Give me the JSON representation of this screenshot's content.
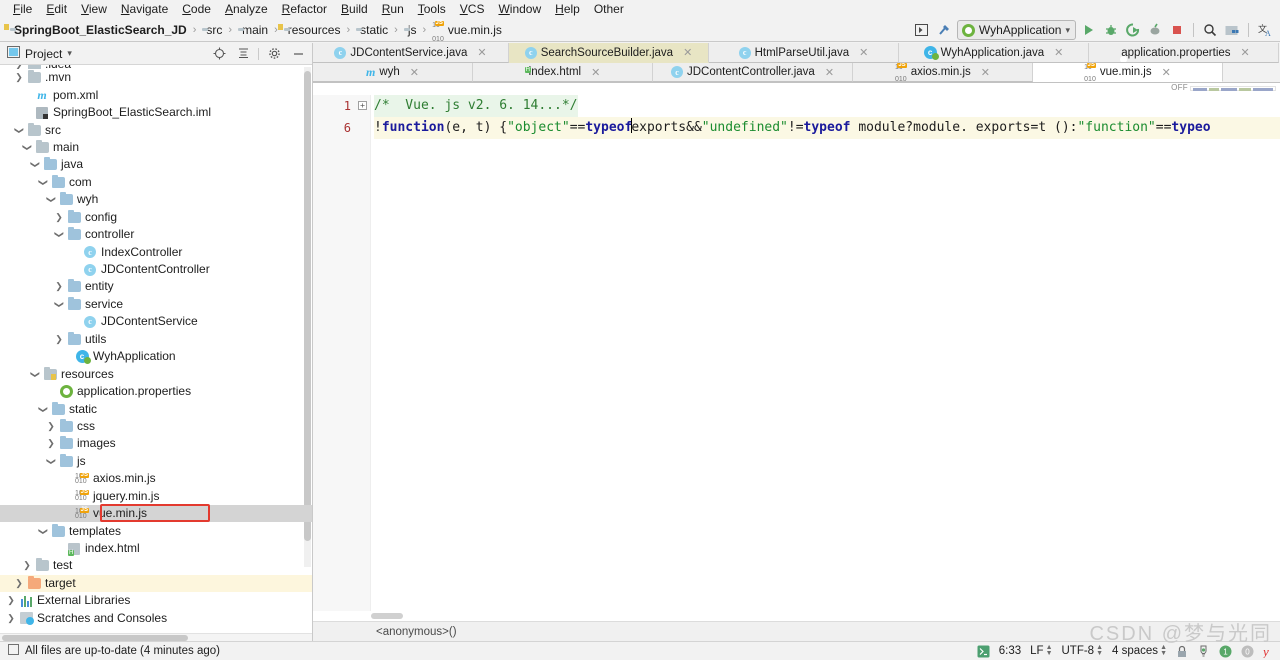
{
  "menubar": {
    "items": [
      "File",
      "Edit",
      "View",
      "Navigate",
      "Code",
      "Analyze",
      "Refactor",
      "Build",
      "Run",
      "Tools",
      "VCS",
      "Window",
      "Help",
      "Other"
    ]
  },
  "navbar": {
    "breadcrumb": [
      {
        "label": "SpringBoot_ElasticSearch_JD",
        "icon": "module-icon"
      },
      {
        "label": "src",
        "icon": "folder-icon"
      },
      {
        "label": "main",
        "icon": "folder-icon"
      },
      {
        "label": "resources",
        "icon": "resources-folder-icon"
      },
      {
        "label": "static",
        "icon": "folder-icon"
      },
      {
        "label": "js",
        "icon": "folder-icon"
      },
      {
        "label": "vue.min.js",
        "icon": "js-file-icon"
      }
    ],
    "run_config": "WyhApplication",
    "icons": [
      "select-opened-file-icon",
      "hammer-build-icon",
      "run-icon",
      "debug-icon",
      "run-coverage-icon",
      "profile-icon",
      "stop-icon",
      "search-icon",
      "project-structure-icon",
      "translate-icon"
    ]
  },
  "project_panel": {
    "title": "Project",
    "toolbar_icons": [
      "locate-icon",
      "collapse-all-icon",
      "settings-gear-icon",
      "hide-icon"
    ],
    "tree": [
      {
        "label": ".idea",
        "depth": 1,
        "arrow": "right",
        "icon": "folder-icon",
        "state": "clipped"
      },
      {
        "label": ".mvn",
        "depth": 1,
        "arrow": "right",
        "icon": "folder-icon"
      },
      {
        "label": "pom.xml",
        "depth": 2,
        "arrow": "",
        "icon": "maven-icon"
      },
      {
        "label": "SpringBoot_ElasticSearch.iml",
        "depth": 2,
        "arrow": "",
        "icon": "iml-icon"
      },
      {
        "label": "src",
        "depth": 1,
        "arrow": "down",
        "icon": "folder-icon"
      },
      {
        "label": "main",
        "depth": 2,
        "arrow": "down",
        "icon": "folder-icon"
      },
      {
        "label": "java",
        "depth": 3,
        "arrow": "down",
        "icon": "source-folder-icon"
      },
      {
        "label": "com",
        "depth": 4,
        "arrow": "down",
        "icon": "package-icon"
      },
      {
        "label": "wyh",
        "depth": 5,
        "arrow": "down",
        "icon": "package-icon"
      },
      {
        "label": "config",
        "depth": 6,
        "arrow": "right",
        "icon": "package-icon"
      },
      {
        "label": "controller",
        "depth": 6,
        "arrow": "down",
        "icon": "package-icon"
      },
      {
        "label": "IndexController",
        "depth": 8,
        "arrow": "",
        "icon": "class-icon"
      },
      {
        "label": "JDContentController",
        "depth": 8,
        "arrow": "",
        "icon": "class-icon"
      },
      {
        "label": "entity",
        "depth": 6,
        "arrow": "right",
        "icon": "package-icon"
      },
      {
        "label": "service",
        "depth": 6,
        "arrow": "down",
        "icon": "package-icon"
      },
      {
        "label": "JDContentService",
        "depth": 8,
        "arrow": "",
        "icon": "class-icon"
      },
      {
        "label": "utils",
        "depth": 6,
        "arrow": "right",
        "icon": "package-icon"
      },
      {
        "label": "WyhApplication",
        "depth": 7,
        "arrow": "",
        "icon": "spring-boot-class-icon"
      },
      {
        "label": "resources",
        "depth": 3,
        "arrow": "down",
        "icon": "resources-folder-icon"
      },
      {
        "label": "application.properties",
        "depth": 5,
        "arrow": "",
        "icon": "spring-properties-icon"
      },
      {
        "label": "static",
        "depth": 4,
        "arrow": "down",
        "icon": "package-icon"
      },
      {
        "label": "css",
        "depth": 5,
        "arrow": "right",
        "icon": "package-icon"
      },
      {
        "label": "images",
        "depth": 5,
        "arrow": "right",
        "icon": "package-icon"
      },
      {
        "label": "js",
        "depth": 5,
        "arrow": "down",
        "icon": "package-icon"
      },
      {
        "label": "axios.min.js",
        "depth": 7,
        "arrow": "",
        "icon": "js-file-icon"
      },
      {
        "label": "jquery.min.js",
        "depth": 7,
        "arrow": "",
        "icon": "js-file-icon"
      },
      {
        "label": "vue.min.js",
        "depth": 7,
        "arrow": "",
        "icon": "js-file-icon",
        "selected": true,
        "highlighted": true
      },
      {
        "label": "templates",
        "depth": 4,
        "arrow": "down",
        "icon": "package-icon"
      },
      {
        "label": "index.html",
        "depth": 6,
        "arrow": "",
        "icon": "html-file-icon"
      },
      {
        "label": "test",
        "depth": 2,
        "arrow": "right",
        "icon": "folder-icon"
      },
      {
        "label": "target",
        "depth": 1,
        "arrow": "right",
        "icon": "target-folder-icon",
        "target": true
      },
      {
        "label": "External Libraries",
        "depth": 0,
        "arrow": "right",
        "icon": "libraries-icon"
      },
      {
        "label": "Scratches and Consoles",
        "depth": 0,
        "arrow": "right",
        "icon": "scratches-icon"
      }
    ]
  },
  "editor": {
    "tabs_row1": [
      {
        "label": "JDContentService.java",
        "icon": "class-icon",
        "state": "normal",
        "closable": true
      },
      {
        "label": "SearchSourceBuilder.java",
        "icon": "class-icon",
        "state": "active-yellow",
        "closable": true
      },
      {
        "label": "HtmlParseUtil.java",
        "icon": "class-icon",
        "state": "normal",
        "closable": true
      },
      {
        "label": "WyhApplication.java",
        "icon": "spring-boot-class-icon",
        "state": "normal",
        "closable": true
      },
      {
        "label": "application.properties",
        "icon": "spring-properties-icon",
        "state": "normal",
        "closable": true
      }
    ],
    "tabs_row2": [
      {
        "label": "wyh",
        "icon": "maven-icon",
        "state": "normal",
        "closable": true
      },
      {
        "label": "index.html",
        "icon": "html-file-icon",
        "state": "normal",
        "closable": true
      },
      {
        "label": "JDContentController.java",
        "icon": "class-icon",
        "state": "normal",
        "closable": true
      },
      {
        "label": "axios.min.js",
        "icon": "js-file-icon",
        "state": "normal",
        "closable": true
      },
      {
        "label": "vue.min.js",
        "icon": "js-file-icon",
        "state": "active-white",
        "closable": true
      }
    ],
    "inspection_status": "OFF",
    "line_numbers": [
      "1",
      "6"
    ],
    "code_lines": [
      {
        "num": "1",
        "tokens": [
          {
            "t": "/*  Vue. js v2. 6. 14...*/",
            "c": "cmt"
          }
        ]
      },
      {
        "num": "6",
        "tokens": [
          {
            "t": "!",
            "c": "pl"
          },
          {
            "t": "function",
            "c": "kw"
          },
          {
            "t": "(e, t) {",
            "c": "pl"
          },
          {
            "t": "\"object\"",
            "c": "str"
          },
          {
            "t": "==",
            "c": "pl"
          },
          {
            "t": "typeof",
            "c": "kw"
          },
          {
            "t": " ",
            "c": "caret"
          },
          {
            "t": "exports&&",
            "c": "pl"
          },
          {
            "t": "\"undefined\"",
            "c": "str"
          },
          {
            "t": "!=",
            "c": "pl"
          },
          {
            "t": "typeof",
            "c": "kw"
          },
          {
            "t": " module?module. exports=t ():",
            "c": "pl"
          },
          {
            "t": "\"function\"",
            "c": "str"
          },
          {
            "t": "==",
            "c": "pl"
          },
          {
            "t": "typeo",
            "c": "kw"
          }
        ]
      }
    ],
    "bottom_breadcrumb": "<anonymous>()"
  },
  "status_bar": {
    "message": "All files are up-to-date (4 minutes ago)",
    "caret_position": "6:33",
    "line_separator": "LF",
    "encoding": "UTF-8",
    "indent": "4 spaces",
    "right_icons": [
      "terminal-icon",
      "lock-icon",
      "inspection-icon",
      "notifications-green-badge",
      "notifications-gray-badge",
      "yandex-y-icon"
    ],
    "notifications_green": "1"
  },
  "watermark": "CSDN @梦与光同"
}
